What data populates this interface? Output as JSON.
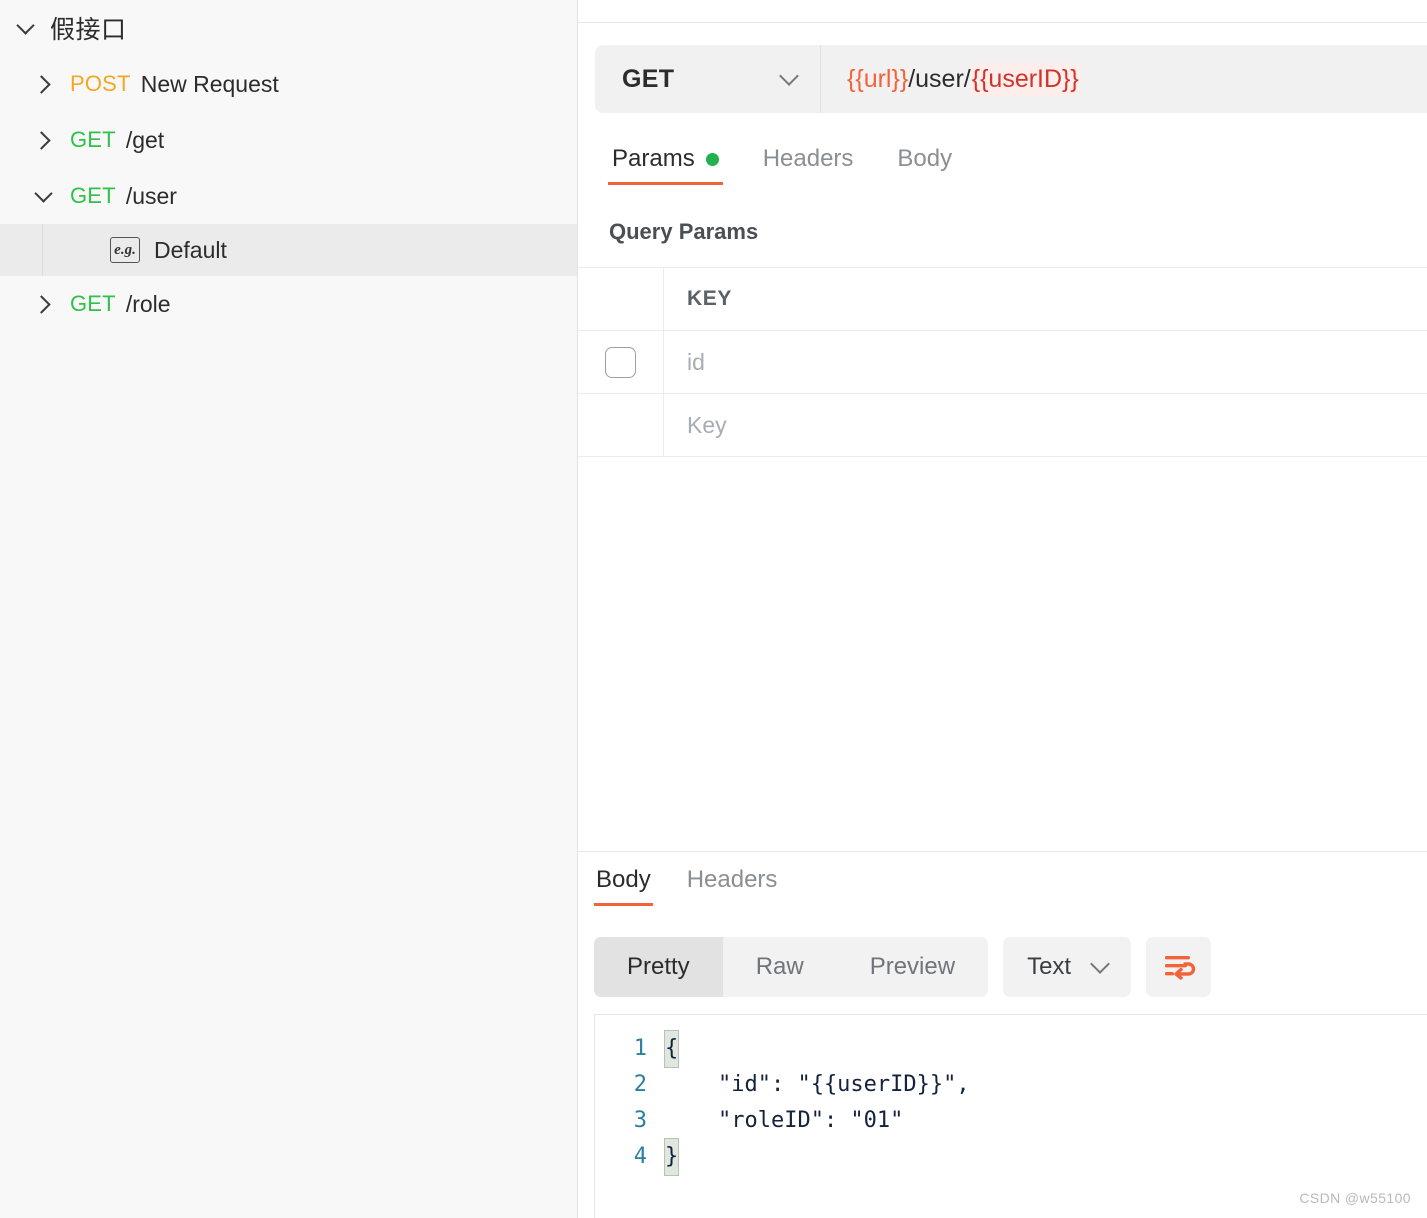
{
  "sidebar": {
    "root": {
      "label": "假接口",
      "expanded": true,
      "caret": "chevron-down-icon"
    },
    "items": [
      {
        "caret": "chevron-right-icon",
        "method": "POST",
        "name": "New Request",
        "expanded": false
      },
      {
        "caret": "chevron-right-icon",
        "method": "GET",
        "name": "/get",
        "expanded": false
      },
      {
        "caret": "chevron-down-icon",
        "method": "GET",
        "name": "/user",
        "expanded": true
      },
      {
        "caret": "chevron-right-icon",
        "method": "GET",
        "name": "/role",
        "expanded": false
      }
    ],
    "child": {
      "icon": "eg-icon",
      "icon_text": "e.g.",
      "label": "Default",
      "selected": true
    }
  },
  "request": {
    "method": "GET",
    "method_caret": "chevron-down-icon",
    "url_parts": [
      {
        "text": "{{url}}",
        "style": "variable"
      },
      {
        "text": "/user/",
        "style": "plain"
      },
      {
        "text": "{{userID}}",
        "style": "variable-highlight"
      }
    ],
    "url_full": "{{url}}/user/{{userID}}",
    "tabs": [
      {
        "label": "Params",
        "active": true,
        "dot": true
      },
      {
        "label": "Headers",
        "active": false,
        "dot": false
      },
      {
        "label": "Body",
        "active": false,
        "dot": false
      }
    ],
    "query_params_title": "Query Params",
    "table": {
      "columns": [
        "",
        "KEY"
      ],
      "rows": [
        {
          "checked": false,
          "key": "id",
          "key_is_placeholder": true
        },
        {
          "checked": null,
          "key": "Key",
          "key_is_placeholder": true
        }
      ]
    }
  },
  "response": {
    "tabs": [
      {
        "label": "Body",
        "active": true
      },
      {
        "label": "Headers",
        "active": false
      }
    ],
    "view_modes": [
      {
        "label": "Pretty",
        "active": true
      },
      {
        "label": "Raw",
        "active": false
      },
      {
        "label": "Preview",
        "active": false
      }
    ],
    "format": {
      "label": "Text",
      "caret": "chevron-down-icon"
    },
    "wrap_button": "word-wrap-icon",
    "code": {
      "lines": [
        {
          "num": "1",
          "pre": "",
          "brace": "{",
          "post": ""
        },
        {
          "num": "2",
          "pre": "    \"id\": \"{{userID}}\",",
          "brace": "",
          "post": ""
        },
        {
          "num": "3",
          "pre": "    \"roleID\": \"01\"",
          "brace": "",
          "post": ""
        },
        {
          "num": "4",
          "pre": "",
          "brace": "}",
          "post": ""
        }
      ]
    }
  },
  "watermark": "CSDN @w55100",
  "colors": {
    "accent": "#f4623a",
    "method_get": "#2ec24a",
    "method_post": "#f5a623",
    "status_dot": "#22b14c",
    "variable": "#f4623a",
    "variable_highlight_text": "#d0342c",
    "variable_highlight_bg": "#fdeeec",
    "sidebar_bg": "#f8f8f8",
    "selected_row_bg": "#ebebeb"
  }
}
